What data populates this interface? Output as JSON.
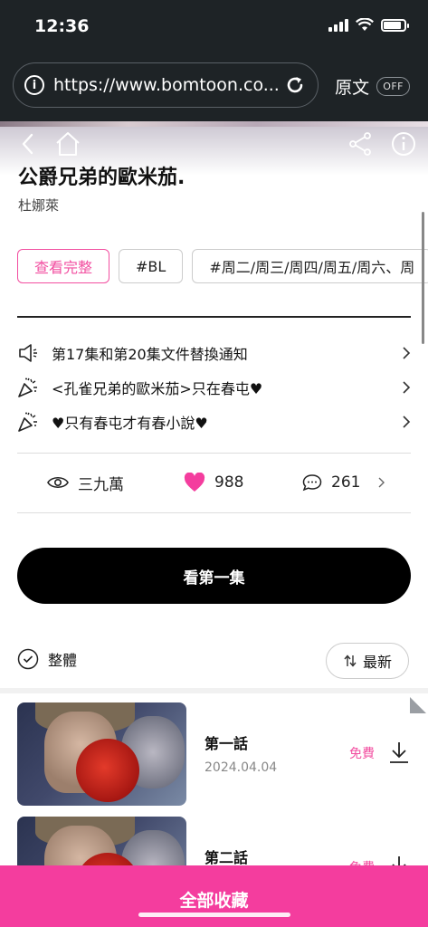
{
  "status_bar": {
    "time": "12:36"
  },
  "browser": {
    "url": "https://www.bomtoon.co...",
    "translate_label": "原文",
    "translate_toggle": "OFF"
  },
  "work": {
    "title": "公爵兄弟的歐米茄.",
    "author": "杜娜萊"
  },
  "tags": [
    {
      "label": "查看完整"
    },
    {
      "label": "#BL"
    },
    {
      "label": "#周二/周三/周四/周五/周六、周"
    }
  ],
  "notices": [
    {
      "icon": "megaphone-icon",
      "text": "第17集和第20集文件替換通知"
    },
    {
      "icon": "party-popper-icon",
      "text": "<孔雀兄弟的歐米茄>只在春屯♥"
    },
    {
      "icon": "party-popper-icon",
      "text": "♥只有春屯才有春小說♥"
    }
  ],
  "stats": {
    "views": "三九萬",
    "likes": "988",
    "comments": "261"
  },
  "read_first_button": "看第一集",
  "list_header": {
    "select_all": "整體",
    "sort": "最新"
  },
  "episodes": [
    {
      "title": "第一話",
      "date": "2024.04.04",
      "price": "免費"
    },
    {
      "title": "第二話",
      "date": "",
      "price": "免費"
    }
  ],
  "bottom_button": "全部收藏",
  "colors": {
    "accent": "#f43d9e",
    "chrome": "#1e2326"
  }
}
